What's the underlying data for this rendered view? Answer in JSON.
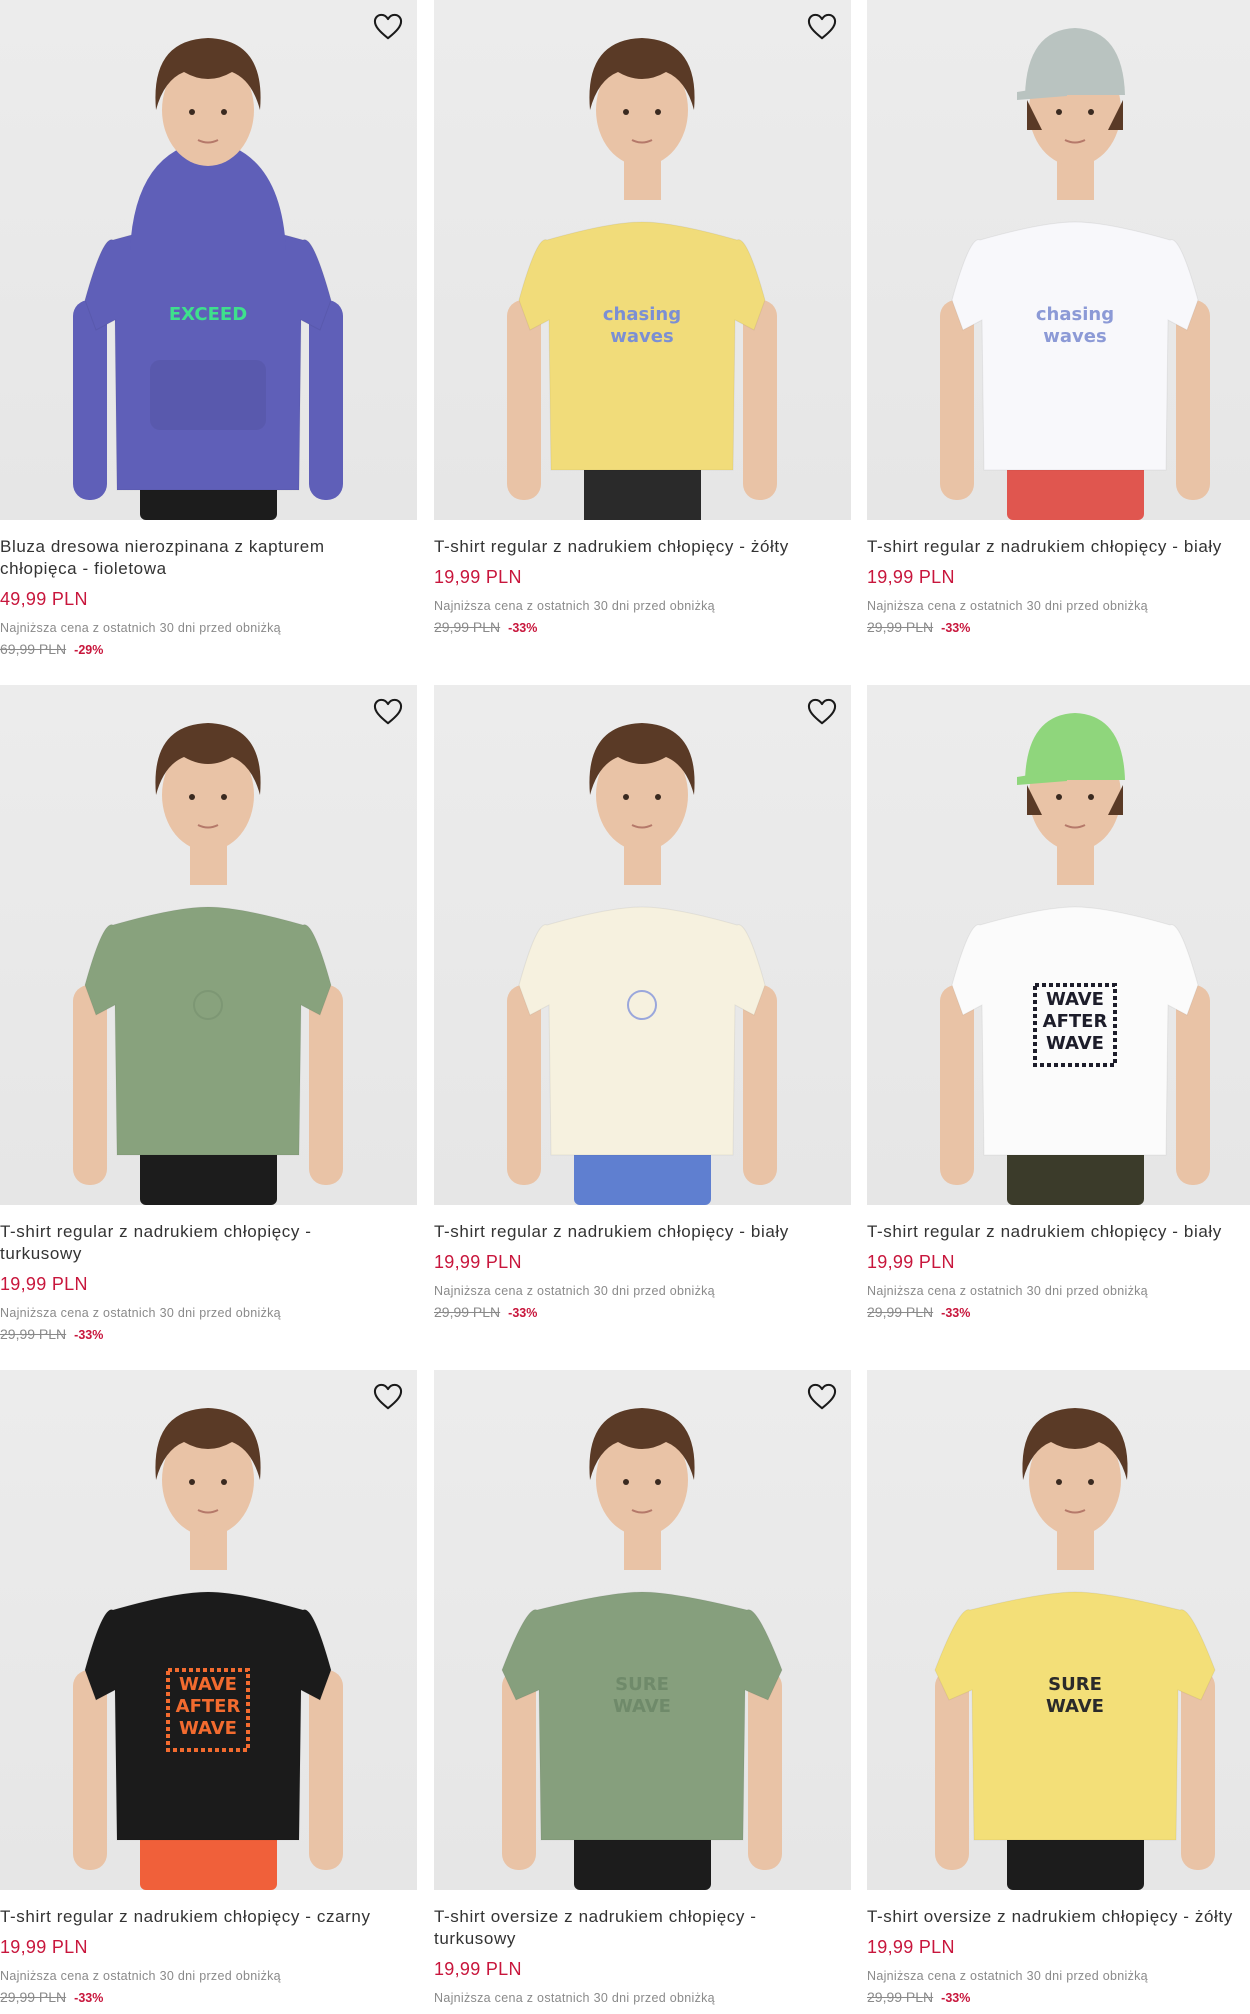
{
  "colors": {
    "price": "#c8163c",
    "muted": "#8a8a8a",
    "photo_bg": "#e9e9e9"
  },
  "icons": {
    "favorite": "heart-outline-icon"
  },
  "products": [
    {
      "title_lines": [
        "Bluza dresowa nierozpinana z kapturem",
        "chłopięca - fioletowa"
      ],
      "price": "49,99 PLN",
      "lowest_label": "Najniższa cena z ostatnich 30 dni przed obniżką",
      "old_price": "69,99 PLN",
      "discount": "-29%",
      "garment_color": "#5f5fb8",
      "garment_type": "hoodie",
      "print_text": "EXCEED",
      "print_color": "#3ee08c",
      "shorts_color": "#1c1c1c",
      "cap_color": ""
    },
    {
      "title_lines": [
        "T-shirt regular z nadrukiem chłopięcy - żółty"
      ],
      "price": "19,99 PLN",
      "lowest_label": "Najniższa cena z ostatnich 30 dni przed obniżką",
      "old_price": "29,99 PLN",
      "discount": "-33%",
      "garment_color": "#f1dc7a",
      "garment_type": "tee",
      "print_text": "chasing waves",
      "print_color": "#7b8fd4",
      "shorts_color": "",
      "cap_color": ""
    },
    {
      "title_lines": [
        "T-shirt regular z nadrukiem chłopięcy - biały"
      ],
      "price": "19,99 PLN",
      "lowest_label": "Najniższa cena z ostatnich 30 dni przed obniżką",
      "old_price": "29,99 PLN",
      "discount": "-33%",
      "garment_color": "#f8f8fb",
      "garment_type": "tee",
      "print_text": "chasing waves",
      "print_color": "#8c9ad6",
      "shorts_color": "#e0564f",
      "cap_color": "#b9c3c0"
    },
    {
      "title_lines": [
        "T-shirt regular z nadrukiem chłopięcy -",
        "turkusowy"
      ],
      "price": "19,99 PLN",
      "lowest_label": "Najniższa cena z ostatnich 30 dni przed obniżką",
      "old_price": "29,99 PLN",
      "discount": "-33%",
      "garment_color": "#88a27d",
      "garment_type": "tee",
      "print_text": "",
      "print_color": "#7d9774",
      "shorts_color": "#1c1c1c",
      "cap_color": ""
    },
    {
      "title_lines": [
        "T-shirt regular z nadrukiem chłopięcy - biały"
      ],
      "price": "19,99 PLN",
      "lowest_label": "Najniższa cena z ostatnich 30 dni przed obniżką",
      "old_price": "29,99 PLN",
      "discount": "-33%",
      "garment_color": "#f6f1df",
      "garment_type": "tee",
      "print_text": "",
      "print_color": "#9aa7dc",
      "shorts_color": "#5f7fd0",
      "cap_color": ""
    },
    {
      "title_lines": [
        "T-shirt regular z nadrukiem chłopięcy - biały"
      ],
      "price": "19,99 PLN",
      "lowest_label": "Najniższa cena z ostatnich 30 dni przed obniżką",
      "old_price": "29,99 PLN",
      "discount": "-33%",
      "garment_color": "#fbfbfb",
      "garment_type": "tee",
      "print_text": "WAVE AFTER WAVE",
      "print_color": "#1d1d2a",
      "shorts_color": "#3b3b2a",
      "cap_color": "#8fd67c"
    },
    {
      "title_lines": [
        "T-shirt regular z nadrukiem chłopięcy - czarny"
      ],
      "price": "19,99 PLN",
      "lowest_label": "Najniższa cena z ostatnich 30 dni przed obniżką",
      "old_price": "29,99 PLN",
      "discount": "-33%",
      "garment_color": "#1b1b1b",
      "garment_type": "tee",
      "print_text": "WAVE AFTER WAVE",
      "print_color": "#f26b2f",
      "shorts_color": "#f0603a",
      "cap_color": ""
    },
    {
      "title_lines": [
        "T-shirt oversize z nadrukiem chłopięcy -",
        "turkusowy"
      ],
      "price": "19,99 PLN",
      "lowest_label": "Najniższa cena z ostatnich 30 dni przed obniżką",
      "old_price": "",
      "discount": "",
      "garment_color": "#869f7d",
      "garment_type": "oversize",
      "print_text": "SURE WAVE",
      "print_color": "#6f8a6a",
      "shorts_color": "#1c1c1c",
      "cap_color": ""
    },
    {
      "title_lines": [
        "T-shirt oversize z nadrukiem chłopięcy - żółty"
      ],
      "price": "19,99 PLN",
      "lowest_label": "Najniższa cena z ostatnich 30 dni przed obniżką",
      "old_price": "29,99 PLN",
      "discount": "-33%",
      "garment_color": "#f3df78",
      "garment_type": "oversize",
      "print_text": "SURE WAVE",
      "print_color": "#2a2a2a",
      "shorts_color": "#1c1c1c",
      "cap_color": ""
    }
  ]
}
